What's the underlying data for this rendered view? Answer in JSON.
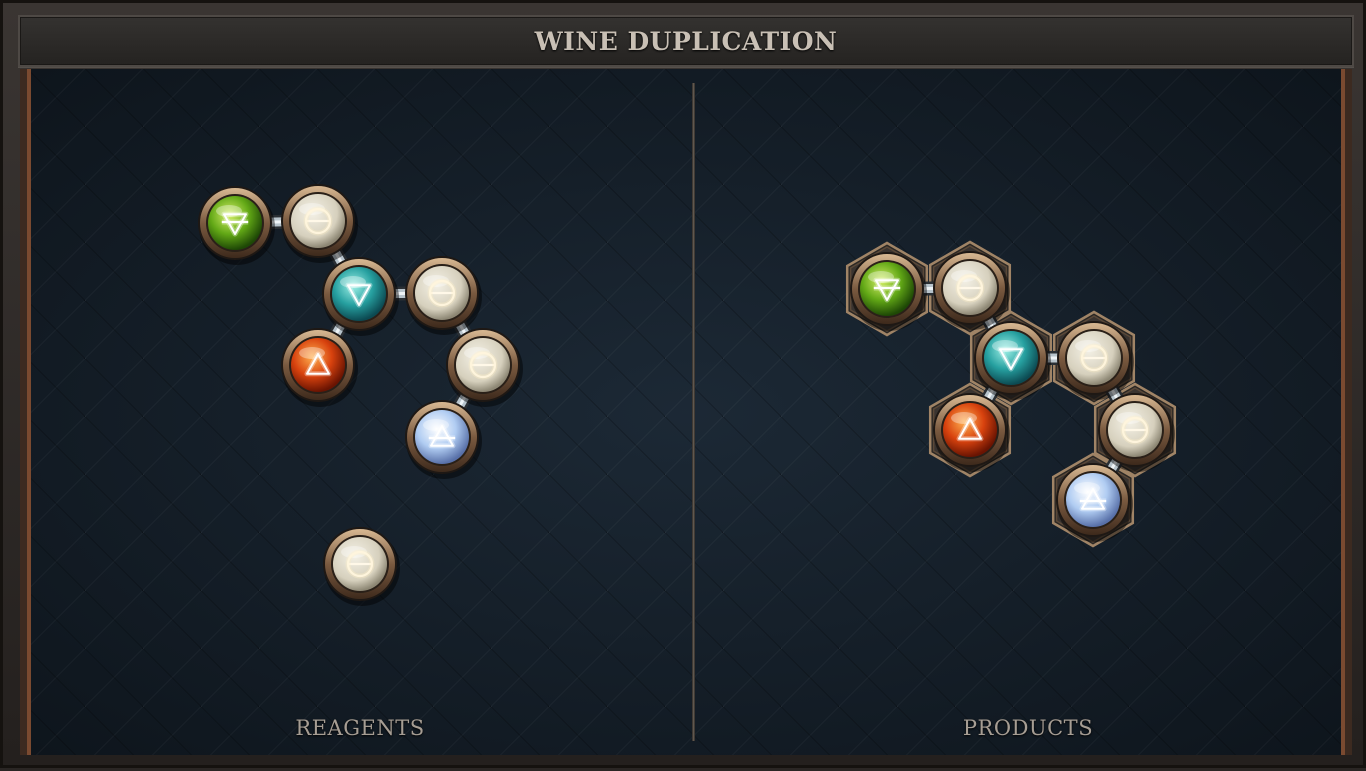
{
  "title": "WINE DUPLICATION",
  "panels": {
    "reagents_label": "REAGENTS",
    "products_label": "PRODUCTS"
  },
  "element_colors": {
    "salt": "#ddd8c6",
    "water": "#2fa8a8",
    "fire": "#d84a10",
    "air": "#a8c8f0",
    "earth": "#6cb018"
  },
  "element_symbols": {
    "salt": "icon-salt",
    "water": "icon-water",
    "fire": "icon-fire",
    "air": "icon-air",
    "earth": "icon-earth"
  },
  "reagents": [
    {
      "element": "earth",
      "count": 1
    },
    {
      "element": "salt",
      "count": 4
    },
    {
      "element": "water",
      "count": 1
    },
    {
      "element": "fire",
      "count": 1
    },
    {
      "element": "air",
      "count": 1
    }
  ],
  "products": [
    {
      "element": "earth",
      "count": 1
    },
    {
      "element": "salt",
      "count": 3
    },
    {
      "element": "water",
      "count": 1
    },
    {
      "element": "fire",
      "count": 1
    },
    {
      "element": "air",
      "count": 1
    }
  ]
}
